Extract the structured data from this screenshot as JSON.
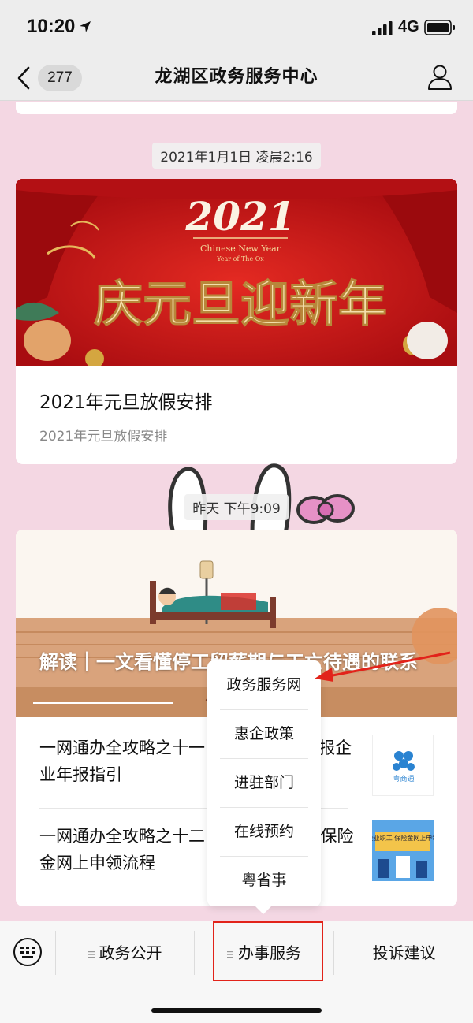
{
  "status_bar": {
    "time": "10:20",
    "network": "4G"
  },
  "nav": {
    "unread_count": "277",
    "title": "龙湖区政务服务中心"
  },
  "messages": [
    {
      "timestamp": "2021年1月1日 凌晨2:16",
      "banner_year": "2021",
      "banner_small": "Chinese New Year",
      "banner_small_2": "Year of The Ox",
      "banner_slogan": "庆元旦迎新年",
      "title": "2021年元旦放假安排",
      "description": "2021年元旦放假安排"
    },
    {
      "timestamp": "昨天 下午9:09",
      "banner_title": "解读｜一文看懂停工留薪期与工亡待遇的联系",
      "banner_caption": "停工",
      "items": [
        {
          "text": "一网通办全攻略之十一 | 粤商通APP填报企业年报指引",
          "thumb_label": "粤商通"
        },
        {
          "text": "一网通办全攻略之十二 | 企业职工失业保险金网上申领流程",
          "thumb_label": "企业职工 保险金网上申领"
        }
      ]
    }
  ],
  "popup_menu": [
    "政务服务网",
    "惠企政策",
    "进驻部门",
    "在线预约",
    "粤省事"
  ],
  "bottom_menu": {
    "tabs": [
      "政务公开",
      "办事服务",
      "投诉建议"
    ]
  },
  "colors": {
    "highlight": "#e2231a",
    "banner_red": "#c61316",
    "gold": "#f3d89a"
  }
}
